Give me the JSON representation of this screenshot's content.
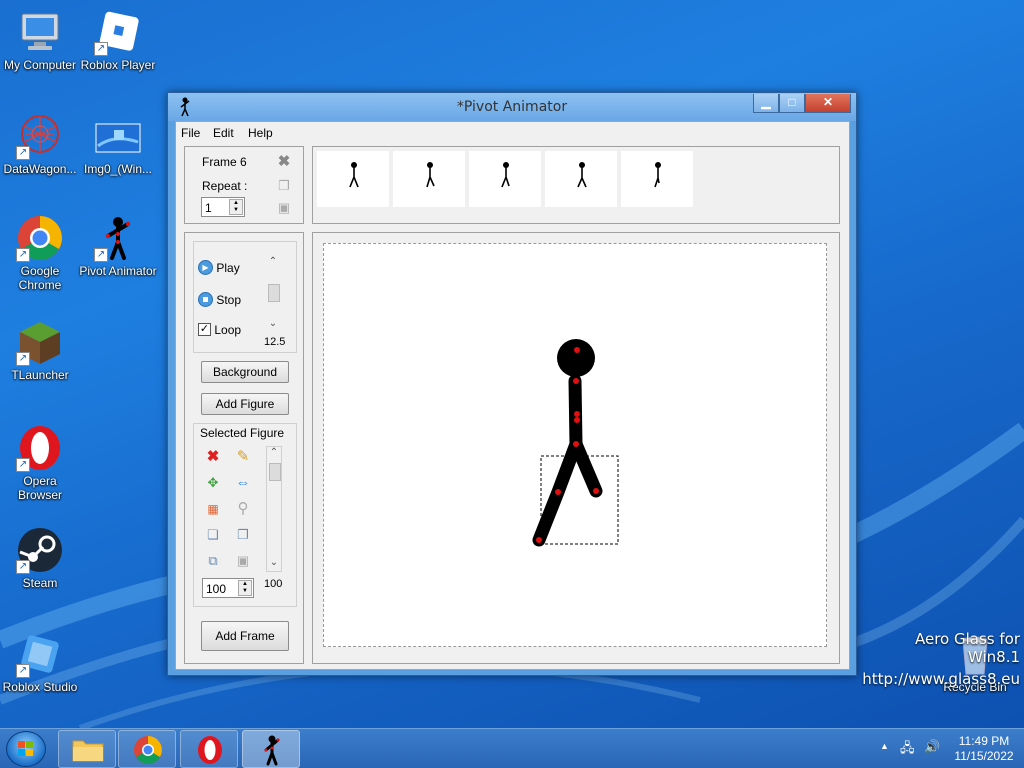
{
  "desktop": {
    "icons": [
      {
        "label": "My Computer"
      },
      {
        "label": "Roblox Player"
      },
      {
        "label": "DataWagon..."
      },
      {
        "label": "Img0_(Win..."
      },
      {
        "label": "Google Chrome"
      },
      {
        "label": "Pivot Animator"
      },
      {
        "label": "TLauncher"
      },
      {
        "label": "Opera Browser"
      },
      {
        "label": "Steam"
      },
      {
        "label": "Roblox Studio"
      },
      {
        "label": "Recycle Bin"
      }
    ],
    "watermark_line1": "Aero Glass for Win8.1",
    "watermark_line2": "http://www.glass8.eu"
  },
  "window": {
    "title": "*Pivot Animator",
    "menu": [
      "File",
      "Edit",
      "Help"
    ],
    "frame_info": {
      "frame_label": "Frame 6",
      "repeat_label": "Repeat :",
      "repeat_value": "1"
    },
    "frame_count": 5,
    "playback": {
      "play": "Play",
      "stop": "Stop",
      "loop": "Loop",
      "loop_checked": true,
      "speed": "12.5"
    },
    "buttons": {
      "background": "Background",
      "add_figure": "Add Figure",
      "add_frame": "Add Frame"
    },
    "selected_figure": {
      "heading": "Selected Figure",
      "size_value": "100",
      "scale_label": "100"
    }
  },
  "taskbar": {
    "time": "11:49 PM",
    "date": "11/15/2022"
  },
  "colors": {
    "accent": "#1e7fe0",
    "joint": "#e01010",
    "figure": "#000000"
  }
}
